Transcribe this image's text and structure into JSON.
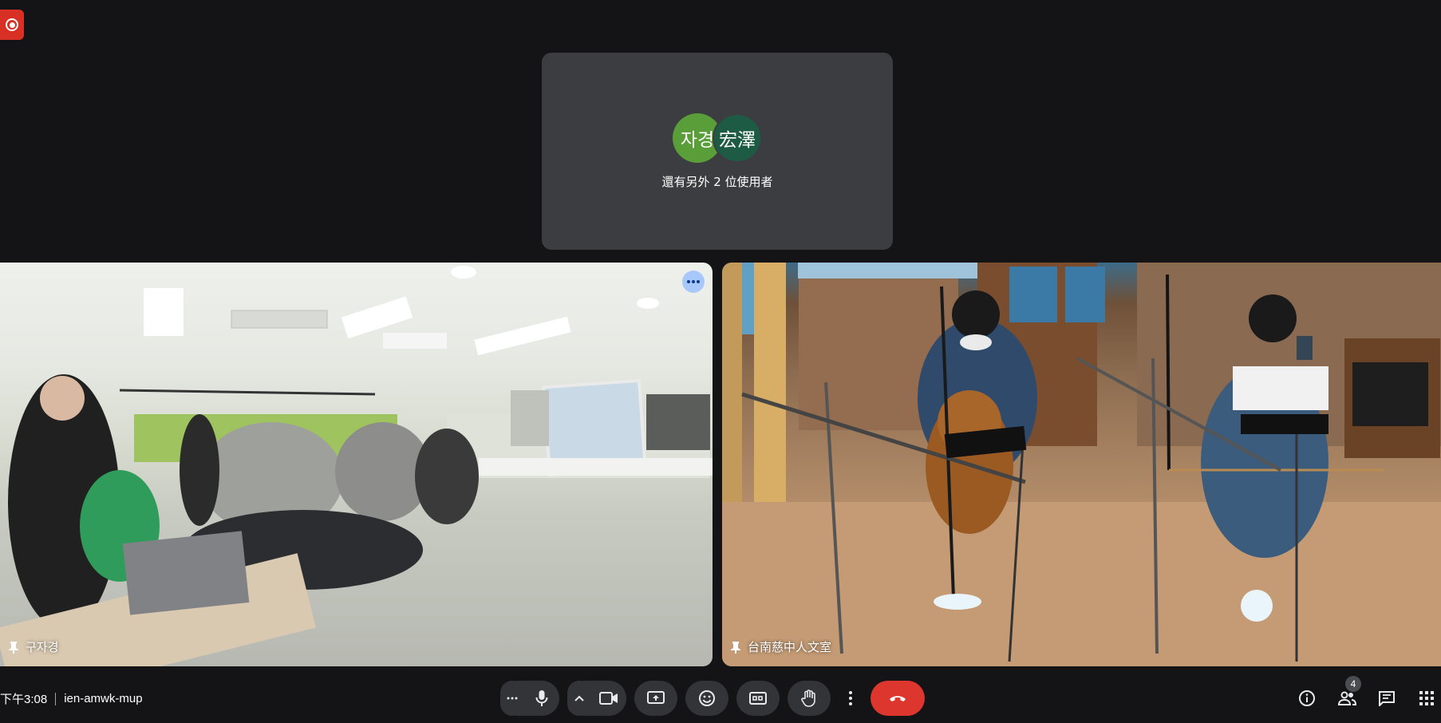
{
  "others_tile": {
    "avatars": [
      "자경",
      "宏澤"
    ],
    "text": "還有另外 2 位使用者"
  },
  "tiles": [
    {
      "name": "구자경",
      "has_more_menu": true
    },
    {
      "name": "台南慈中人文室",
      "has_more_menu": false
    }
  ],
  "meeting": {
    "time": "下午3:08",
    "code": "ien-amwk-mup"
  },
  "participants": {
    "count": "4"
  },
  "colors": {
    "background": "#141417",
    "tile": "#3c3d40",
    "leave": "#dc362e",
    "record": "#d93025",
    "avatar_1": "#5a9e3a",
    "avatar_2": "#1e5b45",
    "more_button": "#a8c7fa"
  }
}
